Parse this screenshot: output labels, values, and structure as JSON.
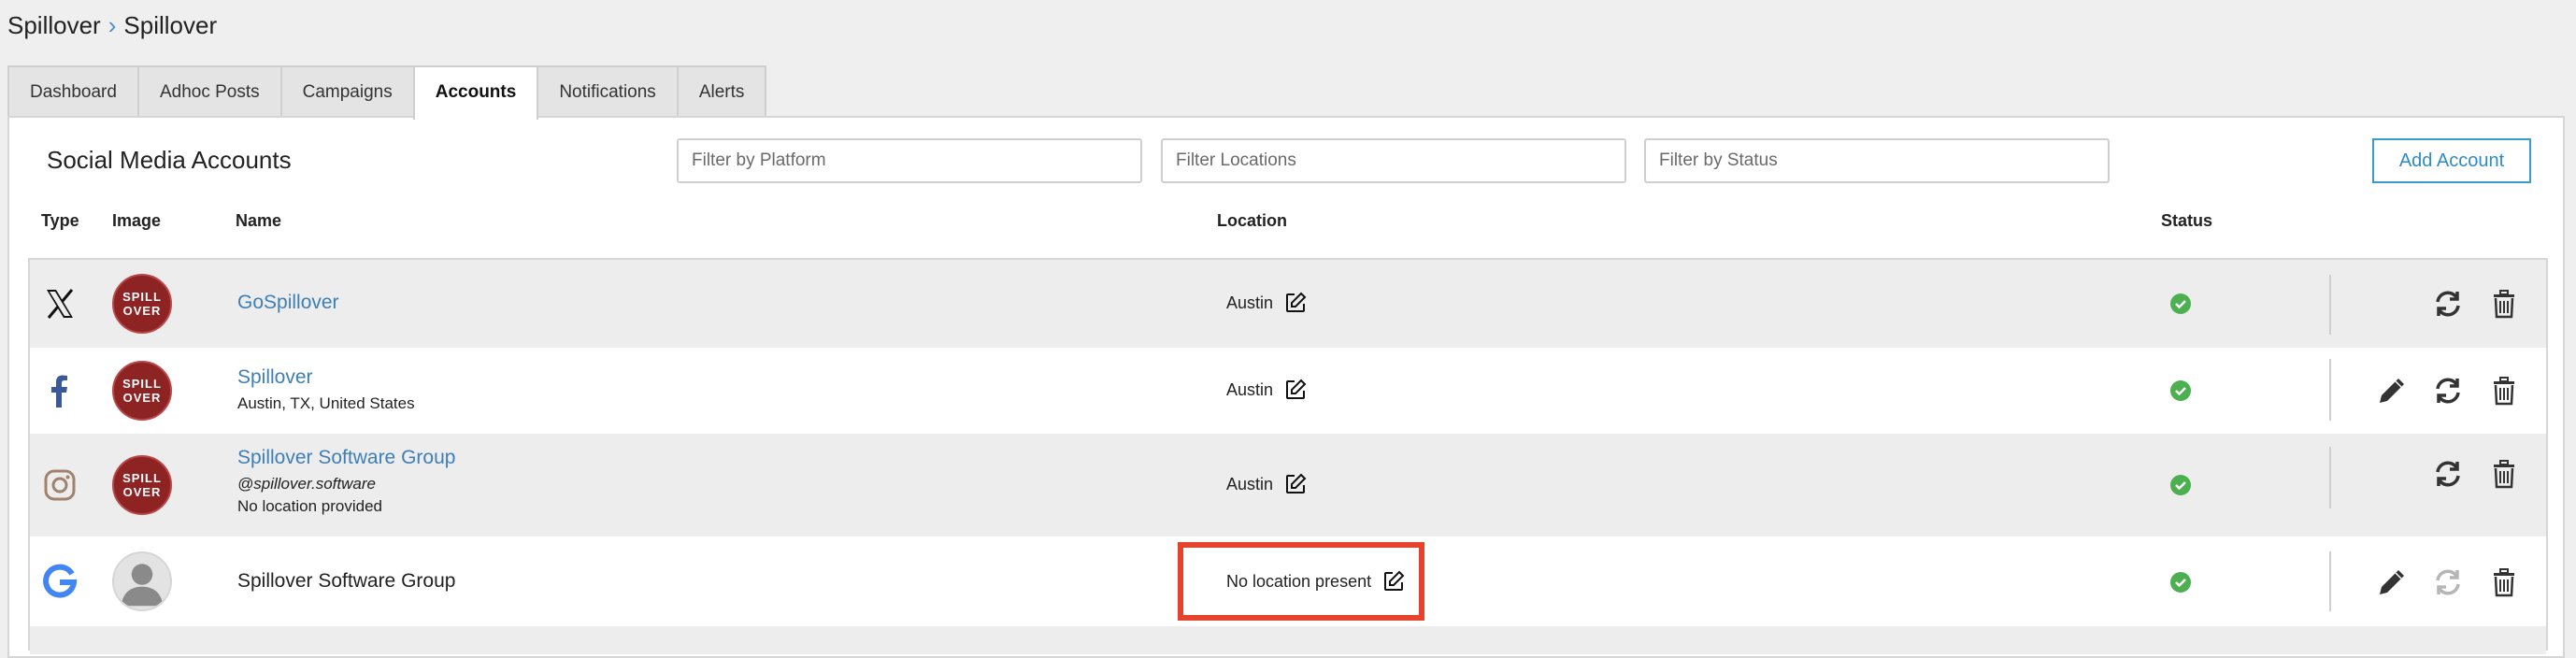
{
  "breadcrumb": {
    "root": "Spillover",
    "current": "Spillover"
  },
  "tabs": [
    {
      "label": "Dashboard",
      "active": false
    },
    {
      "label": "Adhoc Posts",
      "active": false
    },
    {
      "label": "Campaigns",
      "active": false
    },
    {
      "label": "Accounts",
      "active": true
    },
    {
      "label": "Notifications",
      "active": false
    },
    {
      "label": "Alerts",
      "active": false
    }
  ],
  "panel": {
    "title": "Social Media Accounts",
    "filters": {
      "platform_placeholder": "Filter by Platform",
      "locations_placeholder": "Filter Locations",
      "status_placeholder": "Filter by Status"
    },
    "add_button": "Add Account"
  },
  "columns": {
    "type": "Type",
    "image": "Image",
    "name": "Name",
    "location": "Location",
    "status": "Status"
  },
  "avatar_text": {
    "line1": "SPILL",
    "line2": "OVER"
  },
  "accounts": [
    {
      "platform": "x-icon",
      "name": "GoSpillover",
      "location": "Austin",
      "status": "active"
    },
    {
      "platform": "facebook-icon",
      "name": "Spillover",
      "subtitle": "Austin, TX, United States",
      "location": "Austin",
      "status": "active"
    },
    {
      "platform": "instagram-icon",
      "name": "Spillover Software Group",
      "handle": "@spillover.software",
      "subtitle": "No location provided",
      "location": "Austin",
      "status": "active"
    },
    {
      "platform": "google-icon",
      "name": "Spillover Software Group",
      "location": "No location present",
      "status": "active"
    }
  ],
  "colors": {
    "accent": "#3a9bd3",
    "status_ok": "#4caf50",
    "highlight": "#e5432b",
    "brand_avatar": "#8e2324"
  }
}
